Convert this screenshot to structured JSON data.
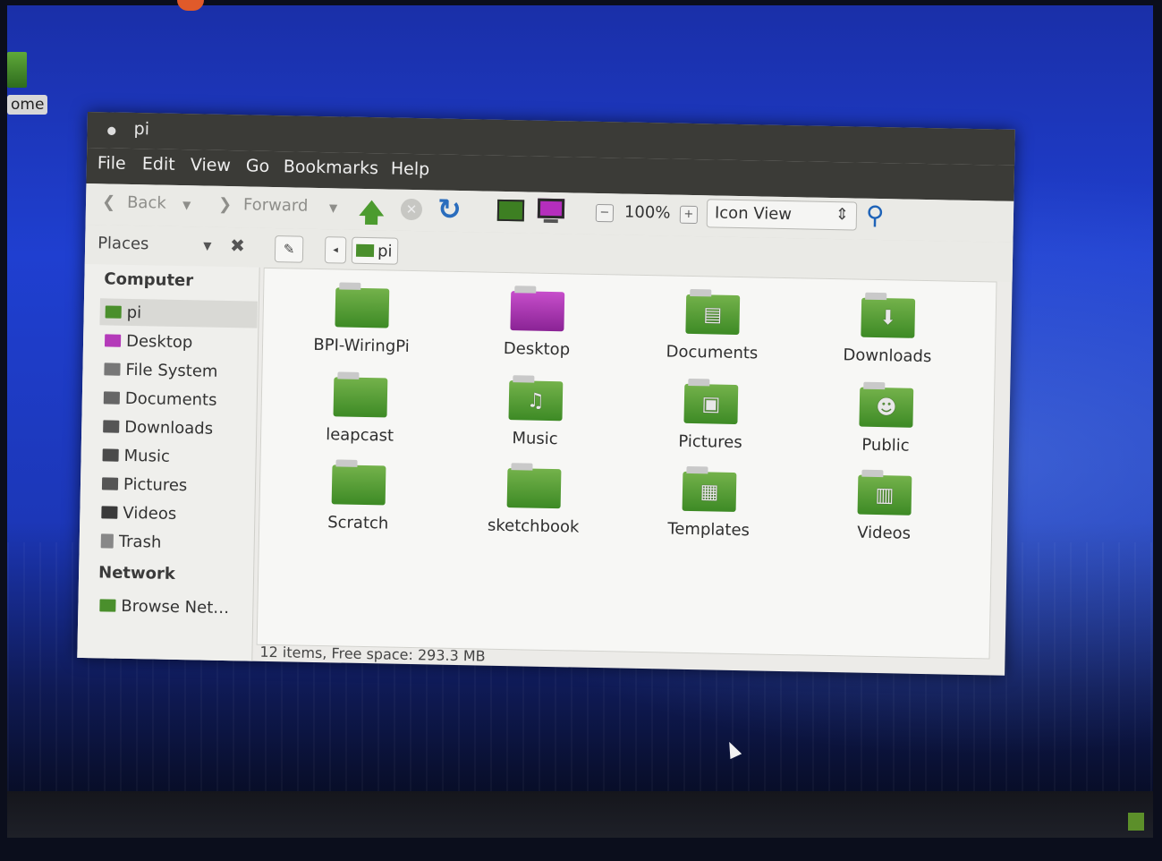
{
  "desktop": {
    "home_label": "ome"
  },
  "window": {
    "title": "pi",
    "menu": [
      "File",
      "Edit",
      "View",
      "Go",
      "Bookmarks",
      "Help"
    ]
  },
  "toolbar": {
    "back_label": "Back",
    "forward_label": "Forward",
    "zoom_level": "100%",
    "view_mode": "Icon View"
  },
  "locationbar": {
    "places_label": "Places",
    "path": "pi"
  },
  "sidebar": {
    "computer_heading": "Computer",
    "network_heading": "Network",
    "items": [
      {
        "label": "pi",
        "icon": "home-folder-icon",
        "color": "#4a8f2c"
      },
      {
        "label": "Desktop",
        "icon": "desktop-folder-icon",
        "color": "#b43ab9"
      },
      {
        "label": "File System",
        "icon": "drive-icon",
        "color": "#777777"
      },
      {
        "label": "Documents",
        "icon": "documents-icon",
        "color": "#666666"
      },
      {
        "label": "Downloads",
        "icon": "downloads-icon",
        "color": "#555555"
      },
      {
        "label": "Music",
        "icon": "music-icon",
        "color": "#4a4a4a"
      },
      {
        "label": "Pictures",
        "icon": "pictures-icon",
        "color": "#555555"
      },
      {
        "label": "Videos",
        "icon": "videos-icon",
        "color": "#3a3a3a"
      },
      {
        "label": "Trash",
        "icon": "trash-icon",
        "color": "#888888"
      }
    ],
    "network_items": [
      {
        "label": "Browse Net…",
        "icon": "network-icon",
        "color": "#4a8f2c"
      }
    ]
  },
  "files": [
    {
      "name": "BPI-WiringPi",
      "emblem": "",
      "color": "green"
    },
    {
      "name": "Desktop",
      "emblem": "",
      "color": "purple"
    },
    {
      "name": "Documents",
      "emblem": "document",
      "color": "green"
    },
    {
      "name": "Downloads",
      "emblem": "download-arrow",
      "color": "green"
    },
    {
      "name": "leapcast",
      "emblem": "",
      "color": "green"
    },
    {
      "name": "Music",
      "emblem": "music-note",
      "color": "green"
    },
    {
      "name": "Pictures",
      "emblem": "picture",
      "color": "green"
    },
    {
      "name": "Public",
      "emblem": "person",
      "color": "green"
    },
    {
      "name": "Scratch",
      "emblem": "",
      "color": "green"
    },
    {
      "name": "sketchbook",
      "emblem": "",
      "color": "green"
    },
    {
      "name": "Templates",
      "emblem": "template",
      "color": "green"
    },
    {
      "name": "Videos",
      "emblem": "film",
      "color": "green"
    }
  ],
  "status": {
    "text": "12 items, Free space: 293.3 MB"
  },
  "colors": {
    "accent_green": "#4c9b2f",
    "accent_purple": "#b43ab9",
    "close_orange": "#e9662f"
  }
}
